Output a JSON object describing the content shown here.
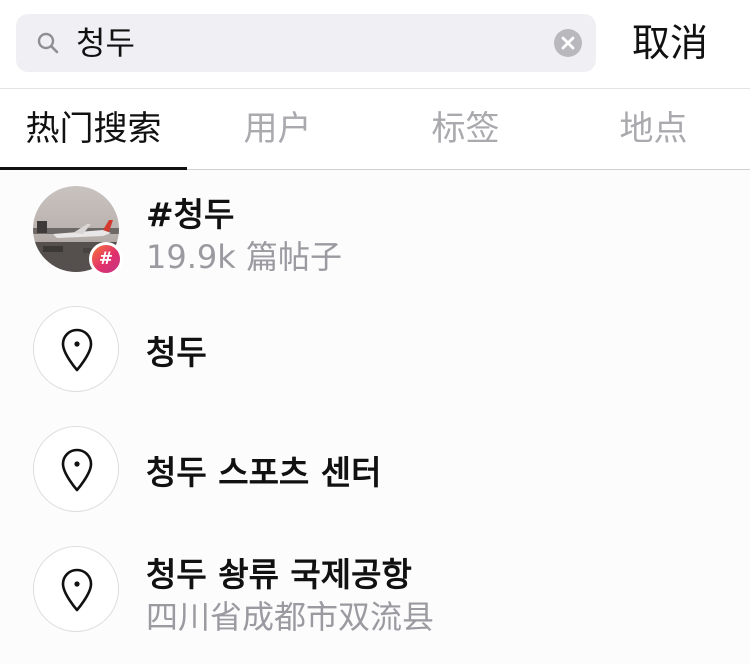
{
  "search": {
    "query": "청두",
    "cancel_label": "取消"
  },
  "tabs": [
    {
      "label": "热门搜索",
      "active": true
    },
    {
      "label": "用户",
      "active": false
    },
    {
      "label": "标签",
      "active": false
    },
    {
      "label": "地点",
      "active": false
    }
  ],
  "results": [
    {
      "type": "hashtag",
      "title": "#청두",
      "subtitle": "19.9k 篇帖子",
      "badge": "#"
    },
    {
      "type": "place",
      "title": "청두",
      "icon": "location-pin-icon"
    },
    {
      "type": "place",
      "title": "청두 스포츠 센터",
      "icon": "location-pin-icon"
    },
    {
      "type": "place",
      "title": "청두 솽류 국제공항",
      "subtitle": "四川省成都市双流县",
      "icon": "location-pin-icon"
    }
  ],
  "colors": {
    "search_bg": "#efeff4",
    "muted_text": "#a9a9ae",
    "hashtag_badge_gradient": [
      "#f77737",
      "#e1306c",
      "#c13584"
    ]
  }
}
